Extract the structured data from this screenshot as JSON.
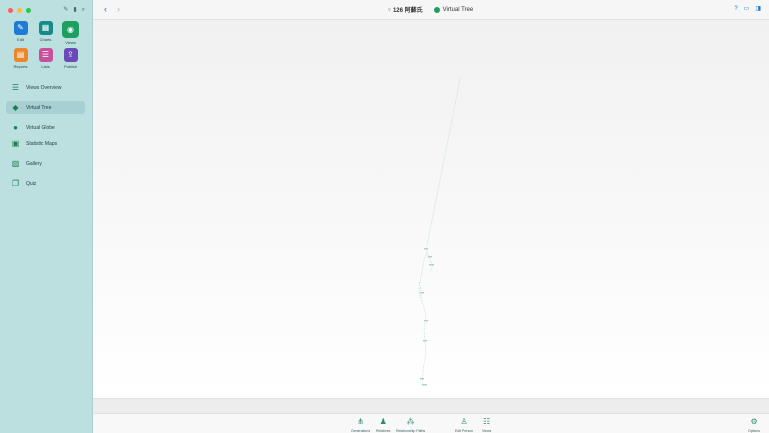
{
  "sidebar": {
    "tools": [
      {
        "label": "Edit",
        "icon": "pencil-icon",
        "color": "#1e7bd6"
      },
      {
        "label": "Charts",
        "icon": "charts-icon",
        "color": "#128b8a"
      },
      {
        "label": "Views",
        "icon": "eye-icon",
        "color": "#1f9e62"
      },
      {
        "label": "Reports",
        "icon": "reports-icon",
        "color": "#e9872c"
      },
      {
        "label": "Lists",
        "icon": "lists-icon",
        "color": "#c9509a"
      },
      {
        "label": "Publish",
        "icon": "publish-icon",
        "color": "#6a49b8"
      }
    ],
    "nav": [
      {
        "label": "Views Overview",
        "icon": "views-overview-icon"
      },
      {
        "label": "Virtual Tree",
        "icon": "virtual-tree-icon",
        "active": true
      },
      {
        "label": "Virtual Globe",
        "icon": "globe-icon"
      },
      {
        "label": "Statistic Maps",
        "icon": "statistic-maps-icon"
      },
      {
        "label": "Gallery",
        "icon": "gallery-icon"
      },
      {
        "label": "Quiz",
        "icon": "quiz-icon"
      }
    ]
  },
  "topbar": {
    "record_title": "126 阿蘇氏",
    "view_title": "Virtual Tree"
  },
  "bottombar": {
    "buttons": [
      {
        "label": "Generations",
        "icon": "generations-icon"
      },
      {
        "label": "Relatives",
        "icon": "relatives-icon"
      },
      {
        "label": "Relationship Paths",
        "icon": "relationship-paths-icon"
      },
      {
        "label": "Edit Person",
        "icon": "edit-person-icon"
      },
      {
        "label": "Views",
        "icon": "views-icon"
      },
      {
        "label": "Options",
        "icon": "options-icon"
      }
    ]
  },
  "colors": {
    "sidebar_bg": "#bcdfe0",
    "accent": "#1f9e62",
    "link_blue": "#1d6fd1"
  }
}
